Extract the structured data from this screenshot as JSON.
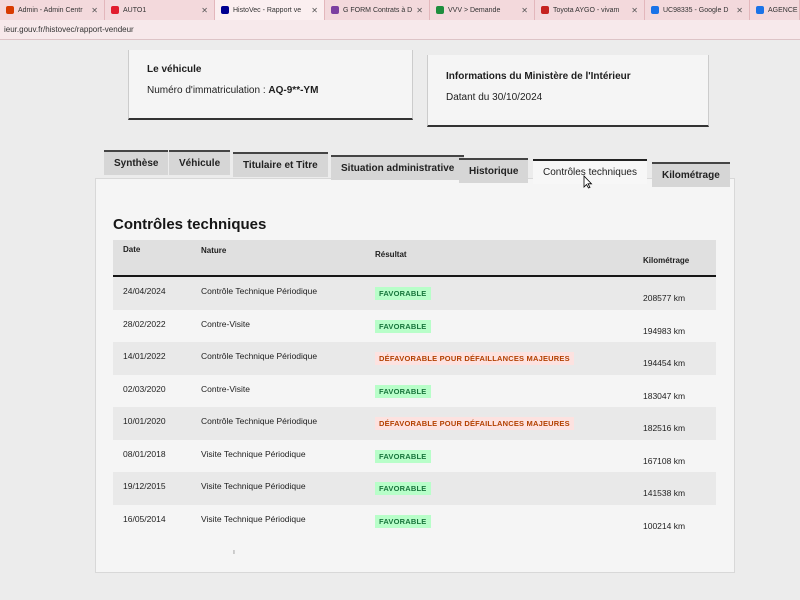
{
  "browser": {
    "tabs": [
      {
        "title": "Admin - Admin Centr",
        "icon": "microsoft-icon",
        "color": "#d83b01",
        "active": false,
        "close": true
      },
      {
        "title": "AUTO1",
        "icon": "auto1-icon",
        "color": "#e11d2e",
        "active": false,
        "close": true
      },
      {
        "title": "HistoVec - Rapport ve",
        "icon": "histovec-icon",
        "color": "#000091",
        "active": true,
        "close": true
      },
      {
        "title": "G FORM Contrats à D",
        "icon": "forms-icon",
        "color": "#7b3fa0",
        "active": false,
        "close": true
      },
      {
        "title": "VVV > Demande",
        "icon": "sheets-icon",
        "color": "#1e8e3e",
        "active": false,
        "close": true
      },
      {
        "title": "Toyota AYGO - vivam",
        "icon": "gmail-icon",
        "color": "#c5221f",
        "active": false,
        "close": true
      },
      {
        "title": "UC98335 - Google D",
        "icon": "drive-icon",
        "color": "#1a73e8",
        "active": false,
        "close": true
      },
      {
        "title": "AGENCE St",
        "icon": "drive-icon",
        "color": "#1a73e8",
        "active": false,
        "close": false
      }
    ],
    "url": "ieur.gouv.fr/histovec/rapport-vendeur"
  },
  "vehicle_card": {
    "title": "Le véhicule",
    "plate_label": "Numéro d'immatriculation : ",
    "plate_value": "AQ-9**-YM"
  },
  "ministry_card": {
    "title": "Informations du Ministère de l'Intérieur",
    "date_text": "Datant du 30/10/2024"
  },
  "tabs": [
    {
      "label": "Synthèse",
      "active": false
    },
    {
      "label": "Véhicule",
      "active": false
    },
    {
      "label": "Titulaire et Titre",
      "active": false
    },
    {
      "label": "Situation administrative",
      "active": false
    },
    {
      "label": "Historique",
      "active": false
    },
    {
      "label": "Contrôles techniques",
      "active": true
    },
    {
      "label": "Kilométrage",
      "active": false
    }
  ],
  "section": {
    "title": "Contrôles techniques",
    "columns": {
      "date": "Date",
      "nature": "Nature",
      "result": "Résultat",
      "km": "Kilométrage"
    },
    "rows": [
      {
        "date": "24/04/2024",
        "nature": "Contrôle Technique Périodique",
        "result": "FAVORABLE",
        "status": "ok",
        "km": "208577 km"
      },
      {
        "date": "28/02/2022",
        "nature": "Contre-Visite",
        "result": "FAVORABLE",
        "status": "ok",
        "km": "194983 km"
      },
      {
        "date": "14/01/2022",
        "nature": "Contrôle Technique Périodique",
        "result": "DÉFAVORABLE POUR DÉFAILLANCES MAJEURES",
        "status": "ko",
        "km": "194454 km"
      },
      {
        "date": "02/03/2020",
        "nature": "Contre-Visite",
        "result": "FAVORABLE",
        "status": "ok",
        "km": "183047 km"
      },
      {
        "date": "10/01/2020",
        "nature": "Contrôle Technique Périodique",
        "result": "DÉFAVORABLE POUR DÉFAILLANCES MAJEURES",
        "status": "ko",
        "km": "182516 km"
      },
      {
        "date": "08/01/2018",
        "nature": "Visite Technique Périodique",
        "result": "FAVORABLE",
        "status": "ok",
        "km": "167108 km"
      },
      {
        "date": "19/12/2015",
        "nature": "Visite Technique Périodique",
        "result": "FAVORABLE",
        "status": "ok",
        "km": "141538 km"
      },
      {
        "date": "16/05/2014",
        "nature": "Visite Technique Périodique",
        "result": "FAVORABLE",
        "status": "ok",
        "km": "100214 km"
      }
    ]
  }
}
